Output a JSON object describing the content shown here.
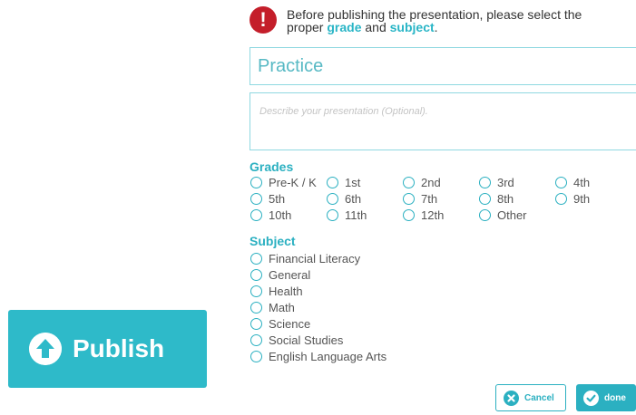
{
  "notice": {
    "line1": "Before publishing the presentation, please select the",
    "line2_prefix": "proper ",
    "grade_word": "grade",
    "and_word": " and ",
    "subject_word": "subject",
    "suffix": "."
  },
  "title_input": {
    "value": "Practice"
  },
  "description_input": {
    "placeholder": "Describe your presentation (Optional)."
  },
  "grades": {
    "title": "Grades",
    "options": [
      "Pre-K / K",
      "1st",
      "2nd",
      "3rd",
      "4th",
      "5th",
      "6th",
      "7th",
      "8th",
      "9th",
      "10th",
      "11th",
      "12th",
      "Other"
    ]
  },
  "subject": {
    "title": "Subject",
    "options": [
      "Financial Literacy",
      "General",
      "Health",
      "Math",
      "Science",
      "Social Studies",
      "English Language Arts"
    ]
  },
  "publish_button": {
    "label": "Publish",
    "icon": "arrow-up-circle-icon"
  },
  "cancel_button": {
    "label": "Cancel",
    "icon": "x-circle-icon"
  },
  "done_button": {
    "label": "done",
    "icon": "check-circle-icon"
  },
  "colors": {
    "accent": "#2bb0c1",
    "publish": "#2ebac9",
    "warning": "#c41e2a"
  }
}
